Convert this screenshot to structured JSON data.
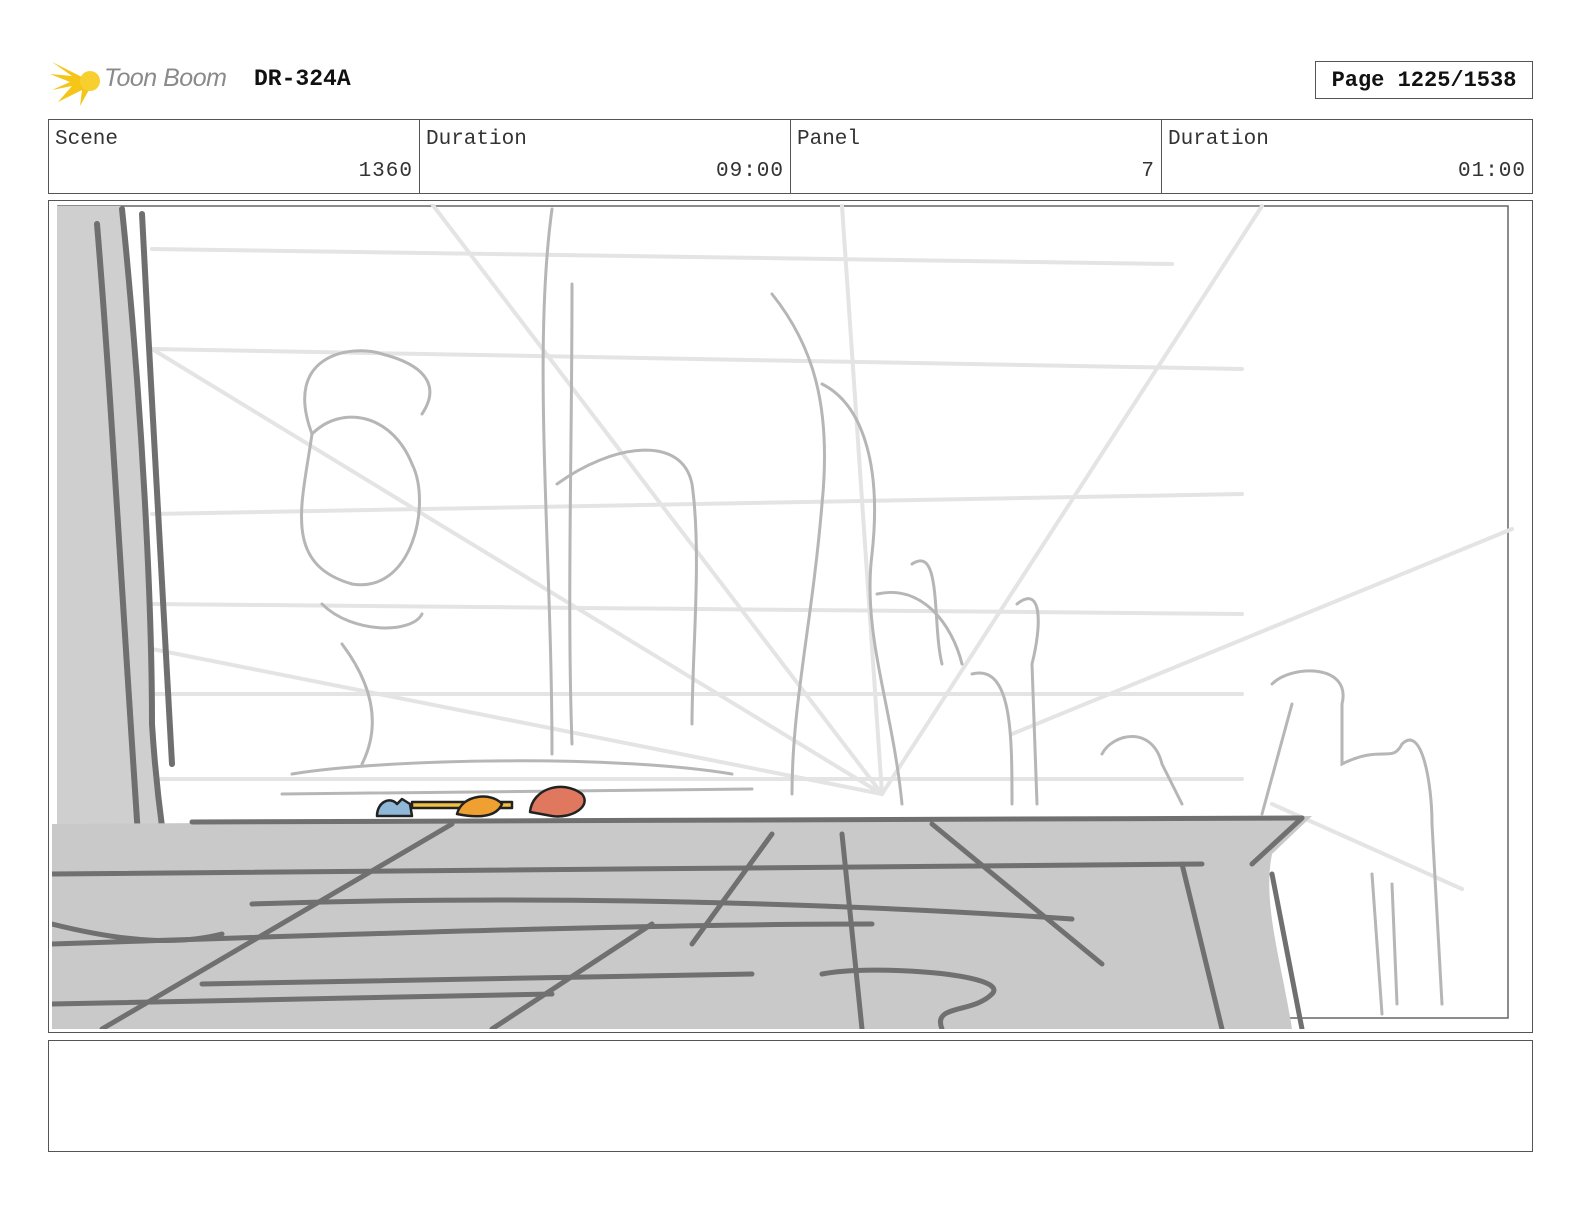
{
  "header": {
    "logo_text": "Toon Boom",
    "project_code": "DR-324A",
    "page_label": "Page 1225/1538"
  },
  "info": {
    "scene_label": "Scene",
    "scene_value": "1360",
    "scene_duration_label": "Duration",
    "scene_duration_value": "09:00",
    "panel_label": "Panel",
    "panel_value": "7",
    "panel_duration_label": "Duration",
    "panel_duration_value": "01:00"
  },
  "notes": {
    "text": ""
  },
  "colors": {
    "logo_burst": "#f5c518",
    "sketch_light": "#d8d8d8",
    "sketch_mid": "#a8a8a8",
    "sketch_dark": "#707070",
    "floor_fill": "#c9c9c9",
    "char_blue": "#8fb7d8",
    "char_orange": "#f0a030",
    "char_red": "#e07860"
  }
}
